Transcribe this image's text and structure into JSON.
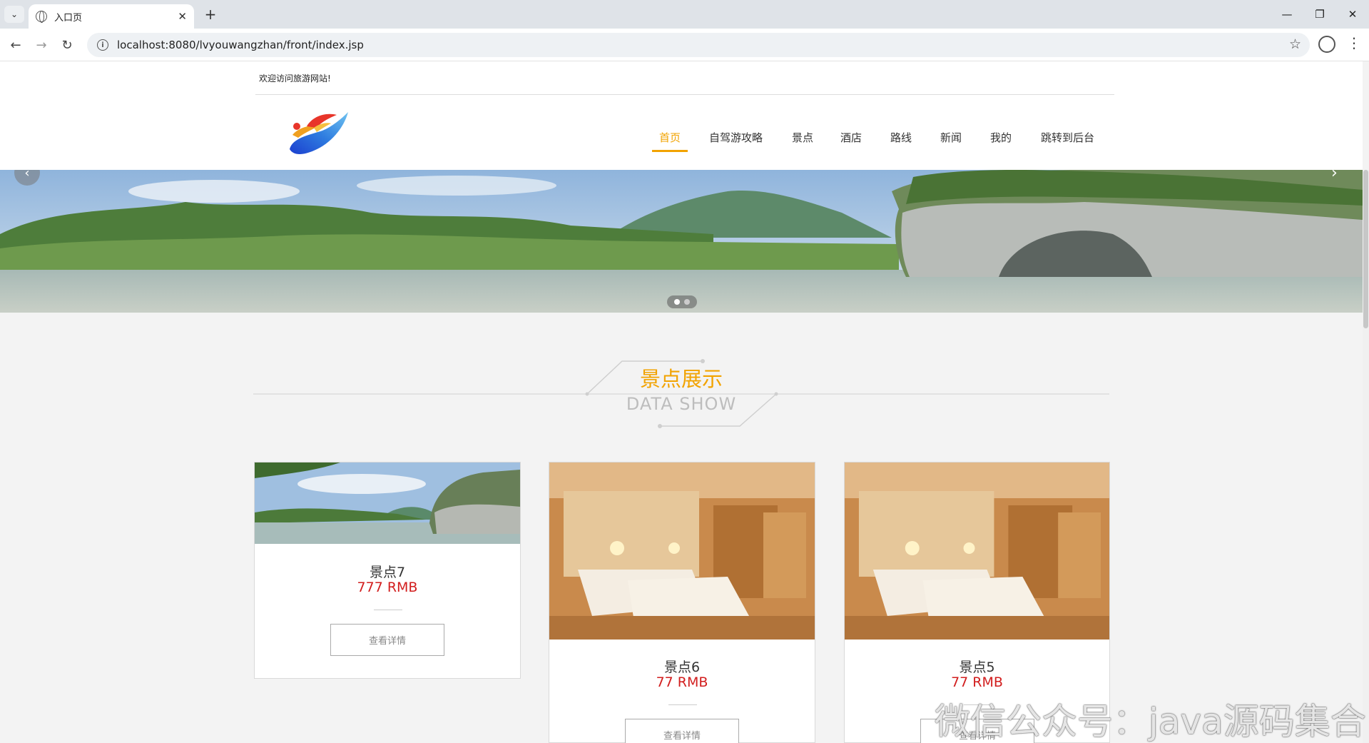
{
  "browser": {
    "tab_title": "入口页",
    "url": "localhost:8080/lvyouwangzhan/front/index.jsp"
  },
  "site": {
    "welcome": "欢迎访问旅游网站!",
    "nav": [
      "首页",
      "自驾游攻略",
      "景点",
      "酒店",
      "路线",
      "新闻",
      "我的",
      "跳转到后台"
    ],
    "active_nav": "首页",
    "accent_color": "#f2a300"
  },
  "section": {
    "title_cn": "景点展示",
    "title_en": "DATA SHOW"
  },
  "cards": [
    {
      "name": "景点7",
      "price": "777 RMB",
      "button": "查看详情",
      "image": "karst-river"
    },
    {
      "name": "景点6",
      "price": "77 RMB",
      "button": "查看详情",
      "image": "hotel-room"
    },
    {
      "name": "景点5",
      "price": "77 RMB",
      "button": "查看详情",
      "image": "hotel-room"
    }
  ],
  "watermark": "微信公众号：java源码集合"
}
